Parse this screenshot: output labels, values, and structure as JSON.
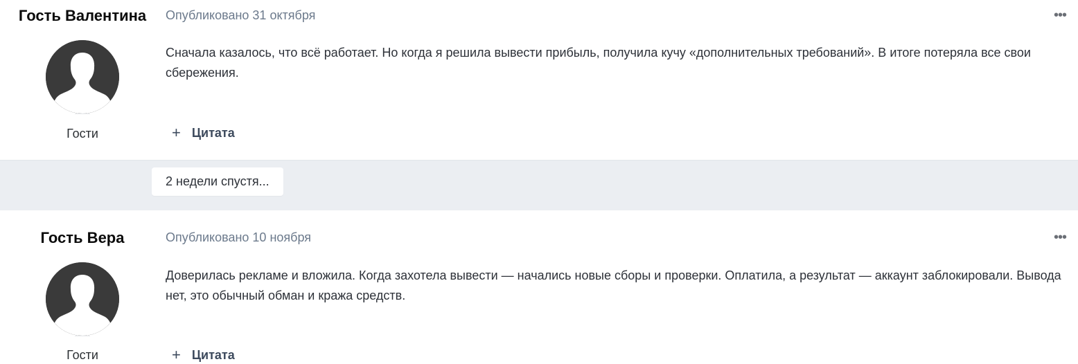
{
  "posts": [
    {
      "author": "Гость Валентина",
      "published": "Опубликовано 31 октября",
      "group": "Гости",
      "content": "Сначала казалось, что всё работает. Но когда я решила вывести прибыль, получила кучу «дополнительных требований». В итоге потеряла все свои сбережения.",
      "quote_label": "Цитата",
      "more_icon": "ellipsis-icon",
      "quote_icon": "plus-icon"
    },
    {
      "author": "Гость Вера",
      "published": "Опубликовано 10 ноября",
      "group": "Гости",
      "content": "Доверилась рекламе и вложила. Когда захотела вывести — начались новые сборы и проверки. Оплатила, а результат — аккаунт заблокировали. Вывода нет, это обычный обман и кража средств.",
      "quote_label": "Цитата",
      "more_icon": "ellipsis-icon",
      "quote_icon": "plus-icon"
    }
  ],
  "separator": {
    "label": "2 недели спустя..."
  },
  "colors": {
    "background": "#ffffff",
    "separator_bg": "#ebeef2",
    "meta_text": "#6c7a8c",
    "quote_text": "#3d4a5d",
    "avatar_bg": "#3a3a3a"
  }
}
